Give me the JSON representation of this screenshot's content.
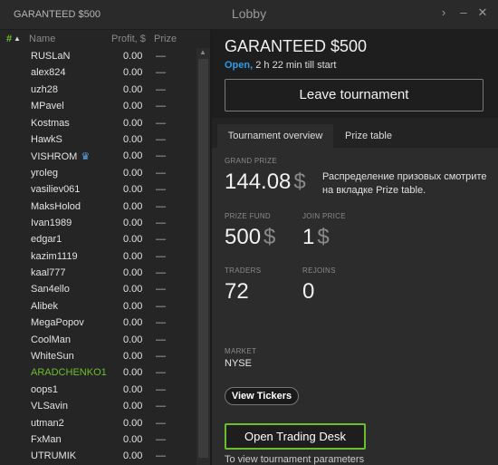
{
  "window": {
    "title": "GARANTEED $500",
    "center_title": "Lobby",
    "controls": {
      "forward": "›",
      "minimize": "–",
      "close": "✕"
    }
  },
  "left": {
    "headers": {
      "sort": "#",
      "sort_arrow": "▲",
      "name": "Name",
      "profit": "Profit, $",
      "prize": "Prize"
    },
    "players": [
      {
        "name": "RUSLaN",
        "profit": "0.00",
        "prize": "—"
      },
      {
        "name": "alex824",
        "profit": "0.00",
        "prize": "—"
      },
      {
        "name": "uzh28",
        "profit": "0.00",
        "prize": "—"
      },
      {
        "name": "MPavel",
        "profit": "0.00",
        "prize": "—"
      },
      {
        "name": "Kostmas",
        "profit": "0.00",
        "prize": "—"
      },
      {
        "name": "HawkS",
        "profit": "0.00",
        "prize": "—"
      },
      {
        "name": "VISHROM",
        "profit": "0.00",
        "prize": "—",
        "badge": "crown"
      },
      {
        "name": "yroleg",
        "profit": "0.00",
        "prize": "—"
      },
      {
        "name": "vasiliev061",
        "profit": "0.00",
        "prize": "—"
      },
      {
        "name": "MaksHolod",
        "profit": "0.00",
        "prize": "—"
      },
      {
        "name": "Ivan1989",
        "profit": "0.00",
        "prize": "—"
      },
      {
        "name": "edgar1",
        "profit": "0.00",
        "prize": "—"
      },
      {
        "name": "kazim1119",
        "profit": "0.00",
        "prize": "—"
      },
      {
        "name": "kaal777",
        "profit": "0.00",
        "prize": "—"
      },
      {
        "name": "San4ello",
        "profit": "0.00",
        "prize": "—"
      },
      {
        "name": "Alibek",
        "profit": "0.00",
        "prize": "—"
      },
      {
        "name": "MegaPopov",
        "profit": "0.00",
        "prize": "—"
      },
      {
        "name": "CoolMan",
        "profit": "0.00",
        "prize": "—"
      },
      {
        "name": "WhiteSun",
        "profit": "0.00",
        "prize": "—"
      },
      {
        "name": "ARADCHENKO1",
        "profit": "0.00",
        "prize": "—",
        "highlight": true
      },
      {
        "name": "oops1",
        "profit": "0.00",
        "prize": "—"
      },
      {
        "name": "VLSavin",
        "profit": "0.00",
        "prize": "—"
      },
      {
        "name": "utman2",
        "profit": "0.00",
        "prize": "—"
      },
      {
        "name": "FxMan",
        "profit": "0.00",
        "prize": "—"
      },
      {
        "name": "UTRUMIK",
        "profit": "0.00",
        "prize": "—"
      }
    ]
  },
  "right": {
    "title": "GARANTEED $500",
    "status_open": "Open,",
    "status_time": " 2 h 22 min till start",
    "leave_button": "Leave tournament",
    "tabs": [
      "Tournament overview",
      "Prize table"
    ],
    "grand_prize_label": "GRAND PRIZE",
    "grand_prize_value": "144.08",
    "currency": "$",
    "grand_prize_desc": "Распределение призовых смотрите на вкладке Prize table.",
    "prize_fund_label": "PRIZE FUND",
    "prize_fund_value": "500",
    "join_price_label": "JOIN PRICE",
    "join_price_value": "1",
    "traders_label": "TRADERS",
    "traders_value": "72",
    "rejoins_label": "REJOINS",
    "rejoins_value": "0",
    "market_label": "MARKET",
    "market_value": "NYSE",
    "view_tickers": "View Tickers",
    "open_trading_desk": "Open Trading Desk",
    "hint": "To view tournament parameters"
  },
  "colors": {
    "accent_blue": "#2f9be8",
    "accent_green": "#6bbf2c",
    "crown": "#5fa6ea"
  }
}
